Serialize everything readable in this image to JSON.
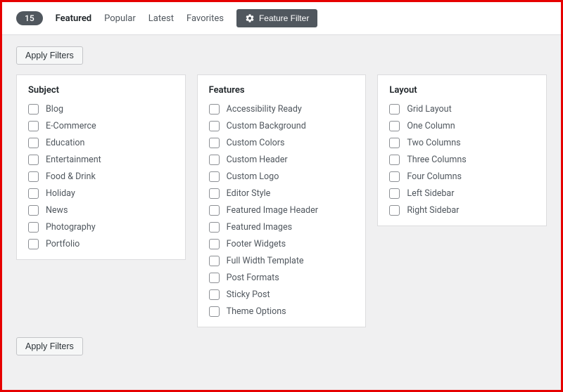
{
  "count": "15",
  "tabs": {
    "featured": "Featured",
    "popular": "Popular",
    "latest": "Latest",
    "favorites": "Favorites"
  },
  "feature_filter_label": "Feature Filter",
  "apply_filters_label": "Apply Filters",
  "panels": {
    "subject": {
      "title": "Subject",
      "items": [
        "Blog",
        "E-Commerce",
        "Education",
        "Entertainment",
        "Food & Drink",
        "Holiday",
        "News",
        "Photography",
        "Portfolio"
      ]
    },
    "features": {
      "title": "Features",
      "items": [
        "Accessibility Ready",
        "Custom Background",
        "Custom Colors",
        "Custom Header",
        "Custom Logo",
        "Editor Style",
        "Featured Image Header",
        "Featured Images",
        "Footer Widgets",
        "Full Width Template",
        "Post Formats",
        "Sticky Post",
        "Theme Options"
      ]
    },
    "layout": {
      "title": "Layout",
      "items": [
        "Grid Layout",
        "One Column",
        "Two Columns",
        "Three Columns",
        "Four Columns",
        "Left Sidebar",
        "Right Sidebar"
      ]
    }
  }
}
